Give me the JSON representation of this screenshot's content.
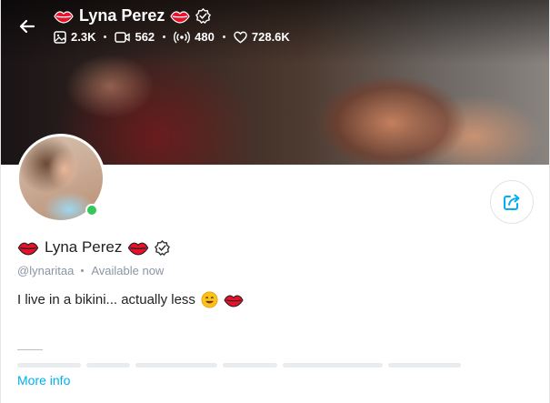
{
  "header": {
    "name": "Lyna Perez",
    "stats": [
      {
        "icon": "image-icon",
        "value": "2.3K"
      },
      {
        "icon": "video-icon",
        "value": "562"
      },
      {
        "icon": "broadcast-icon",
        "value": "480"
      },
      {
        "icon": "heart-icon",
        "value": "728.6K"
      }
    ]
  },
  "profile": {
    "name": "Lyna Perez",
    "handle": "@lynaritaa",
    "status": "Available now",
    "bio": "I live in a bikini... actually less",
    "more_info": "More info"
  },
  "colors": {
    "accent": "#00aff0",
    "online": "#34c759",
    "lips": "#e8102a",
    "muted": "#8a96a3"
  }
}
